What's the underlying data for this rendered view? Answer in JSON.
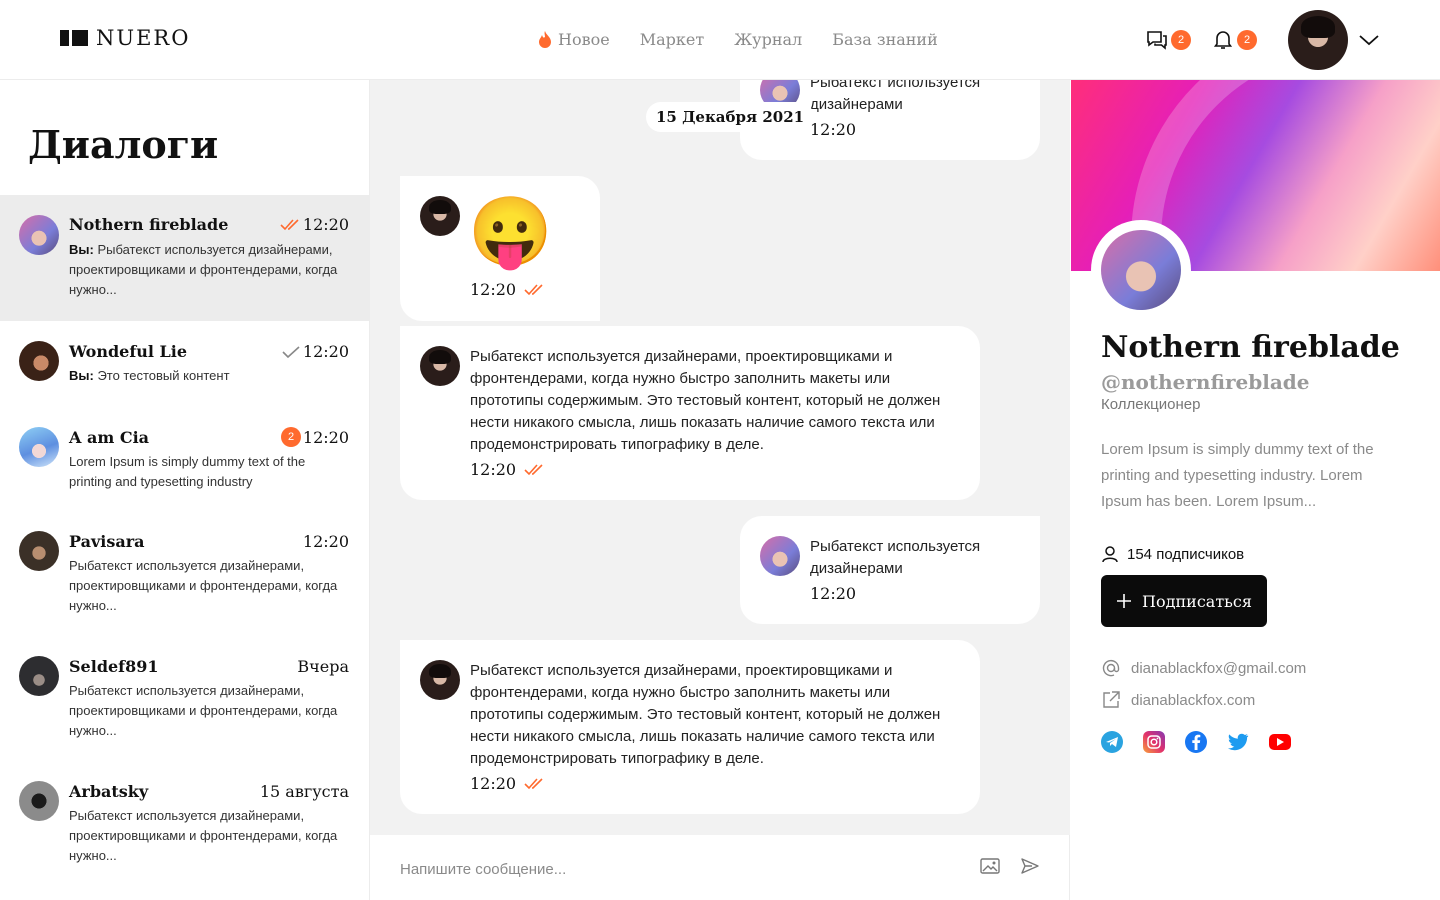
{
  "header": {
    "logo_text": "NUERO",
    "nav": [
      {
        "label": "Новое",
        "icon": "fire-icon"
      },
      {
        "label": "Маркет"
      },
      {
        "label": "Журнал"
      },
      {
        "label": "База знаний"
      }
    ],
    "messages_badge": "2",
    "notifications_badge": "2"
  },
  "sidebar": {
    "title": "Диалоги",
    "dialogs": [
      {
        "name": "Nothern fireblade",
        "time": "12:20",
        "status": "read",
        "you_prefix": "Вы:",
        "preview": " Рыбатекст используется дизайнерами, проектировщиками и фронтендерами, когда нужно..."
      },
      {
        "name": "Wondeful Lie",
        "time": "12:20",
        "status": "sent",
        "you_prefix": "Вы:",
        "preview": " Это тестовый контент"
      },
      {
        "name": "A am Cia",
        "time": "12:20",
        "unread": "2",
        "preview": "Lorem Ipsum is simply dummy text of the printing and typesetting industry"
      },
      {
        "name": "Pavisara",
        "time": "12:20",
        "preview": "Рыбатекст используется дизайнерами, проектировщиками и фронтендерами, когда нужно..."
      },
      {
        "name": "Seldef891",
        "time": "Вчера",
        "preview": "Рыбатекст используется дизайнерами, проектировщиками и фронтендерами, когда нужно..."
      },
      {
        "name": "Arbatsky",
        "time": "15 августа",
        "preview": "Рыбатекст используется дизайнерами, проектировщиками и фронтендерами, когда нужно..."
      }
    ]
  },
  "chat": {
    "date_label": "15 Декабря 2021",
    "messages": [
      {
        "from": "other",
        "text": "Рыбатекст используется дизайнерами",
        "time": "12:20"
      },
      {
        "from": "me",
        "emoji": "😛",
        "time": "12:20"
      },
      {
        "from": "me",
        "text": "Рыбатекст используется дизайнерами, проектировщиками и фронтендерами, когда нужно быстро заполнить макеты или прототипы содержимым. Это тестовый контент, который не должен нести никакого смысла, лишь показать наличие самого текста или продемонстрировать типографику в деле.",
        "time": "12:20"
      },
      {
        "from": "other",
        "text": "Рыбатекст используется дизайнерами",
        "time": "12:20"
      },
      {
        "from": "me",
        "text": "Рыбатекст используется дизайнерами, проектировщиками и фронтендерами, когда нужно быстро заполнить макеты или прототипы содержимым. Это тестовый контент, который не должен нести никакого смысла, лишь показать наличие самого текста или продемонстрировать типографику в деле.",
        "time": "12:20"
      }
    ],
    "composer_placeholder": "Напишите сообщение..."
  },
  "profile": {
    "name": "Nothern fireblade",
    "handle": "@nothernfireblade",
    "role": "Коллекционер",
    "bio": "Lorem Ipsum is simply dummy text of the printing and typesetting industry. Lorem Ipsum has been. Lorem Ipsum...",
    "subscribers": "154 подписчиков",
    "subscribe_label": "Подписаться",
    "email": "dianablackfox@gmail.com",
    "website": "dianablackfox.com",
    "socials": [
      "telegram-icon",
      "instagram-icon",
      "facebook-icon",
      "twitter-icon",
      "youtube-icon"
    ]
  },
  "colors": {
    "accent": "#ff6a2e",
    "chat_bg": "#f2f2f2",
    "active_dialog": "#ececec"
  }
}
